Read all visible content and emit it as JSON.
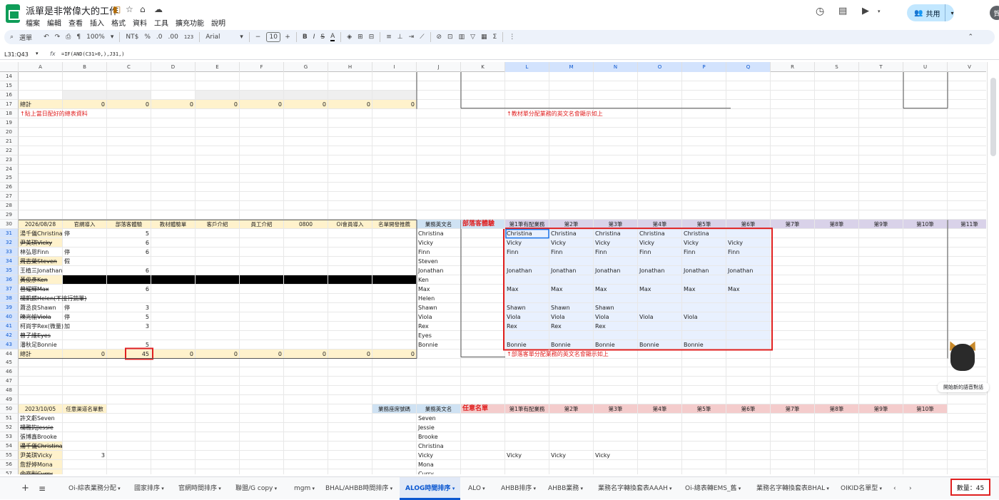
{
  "app": {
    "title": "派單是非常偉大的工作",
    "share_label": "共用",
    "avatar": "賀"
  },
  "menu": [
    "檔案",
    "編輯",
    "查看",
    "插入",
    "格式",
    "資料",
    "工具",
    "擴充功能",
    "說明"
  ],
  "toolbar": {
    "menu_search": "選單",
    "zoom": "100%",
    "currency": "NT$",
    "percent": "%",
    "dec_dec": ".0",
    "dec_inc": ".00",
    "format123": "123",
    "font": "Arial",
    "font_size": "10",
    "functions": "Σ"
  },
  "formula_bar": {
    "name_box": "L31:Q43",
    "fx": "fx",
    "formula": "=IF(AND(C31>0,),J31,)"
  },
  "columns": [
    "A",
    "B",
    "C",
    "D",
    "E",
    "F",
    "G",
    "H",
    "I",
    "J",
    "K",
    "L",
    "M",
    "N",
    "O",
    "P",
    "Q",
    "R",
    "S",
    "T",
    "U",
    "V"
  ],
  "rows": {
    "14": {},
    "15": {},
    "16": {},
    "17": {
      "A": "總計",
      "B": "0",
      "C": "0",
      "D": "0",
      "E": "0",
      "F": "0",
      "G": "0",
      "H": "0",
      "I": "0"
    },
    "18": {
      "A": "↑貼上當日配好的總表資料",
      "L": "↑教材單分配業務的英文名會顯示如上"
    },
    "19": {},
    "20": {},
    "21": {},
    "22": {},
    "23": {},
    "24": {},
    "25": {},
    "26": {},
    "27": {},
    "28": {},
    "29": {},
    "30": {
      "A": "2026/08/28",
      "B": "官網導入",
      "C": "部落客體驗",
      "D": "教材體驗單",
      "E": "客戶介紹",
      "F": "員工介紹",
      "G": "0800",
      "H": "Oi會員導入",
      "I": "名單開發推薦",
      "J": "業務英文名",
      "K": "部落客體驗",
      "L": "第1筆有配業務",
      "M": "第2筆",
      "N": "第3筆",
      "O": "第4筆",
      "P": "第5筆",
      "Q": "第6筆",
      "R": "第7筆",
      "S": "第8筆",
      "T": "第9筆",
      "U": "第10筆",
      "V": "第11筆"
    },
    "31": {
      "A": "湯千儀Christina",
      "B": "停",
      "C": "5",
      "J": "Christina",
      "L": "Christina",
      "M": "Christina",
      "N": "Christina",
      "O": "Christina",
      "P": "Christina"
    },
    "32": {
      "A": "尹美琪Vicky",
      "C": "6",
      "J": "Vicky",
      "L": "Vicky",
      "M": "Vicky",
      "N": "Vicky",
      "O": "Vicky",
      "P": "Vicky",
      "Q": "Vicky"
    },
    "33": {
      "A": "林弘恩Finn",
      "B": "停",
      "C": "6",
      "J": "Finn",
      "L": "Finn",
      "M": "Finn",
      "N": "Finn",
      "O": "Finn",
      "P": "Finn",
      "Q": "Finn"
    },
    "34": {
      "A": "周志榮Steven",
      "B": "假",
      "J": "Steven"
    },
    "35": {
      "A": "王植三Jonathan",
      "C": "6",
      "J": "Jonathan",
      "L": "Jonathan",
      "M": "Jonathan",
      "N": "Jonathan",
      "O": "Jonathan",
      "P": "Jonathan",
      "Q": "Jonathan"
    },
    "36": {
      "A": "黃俊彥Ken",
      "J": "Ken"
    },
    "37": {
      "A": "曾耀輝Max",
      "C": "6",
      "J": "Max",
      "L": "Max",
      "M": "Max",
      "N": "Max",
      "O": "Max",
      "P": "Max",
      "Q": "Max"
    },
    "38": {
      "A": "楊凱麟Helen(不接行銷單)",
      "J": "Helen"
    },
    "39": {
      "A": "蕭丞良Shawn",
      "B": "停",
      "C": "3",
      "J": "Shawn",
      "L": "Shawn",
      "M": "Shawn",
      "N": "Shawn"
    },
    "40": {
      "A": "陳兆愉Viola",
      "B": "停",
      "C": "5",
      "J": "Viola",
      "L": "Viola",
      "M": "Viola",
      "N": "Viola",
      "O": "Viola",
      "P": "Viola"
    },
    "41": {
      "A": "柯尚宇Rex(微量)",
      "B": "加",
      "C": "3",
      "J": "Rex",
      "L": "Rex",
      "M": "Rex",
      "N": "Rex"
    },
    "42": {
      "A": "曾子維Eyes",
      "J": "Eyes"
    },
    "43": {
      "A": "潘秋足Bonnie",
      "C": "5",
      "J": "Bonnie",
      "L": "Bonnie",
      "M": "Bonnie",
      "N": "Bonnie",
      "O": "Bonnie",
      "P": "Bonnie"
    },
    "44": {
      "A": "總計",
      "B": "0",
      "C": "45",
      "D": "0",
      "E": "0",
      "F": "0",
      "G": "0",
      "H": "0",
      "I": "0",
      "L": "↑部落客單分配業務的英文名會顯示如上"
    },
    "45": {},
    "46": {},
    "47": {},
    "48": {},
    "49": {},
    "50": {
      "A": "2023/10/05",
      "B": "任意渠道名單數",
      "I": "業務座席號碼",
      "J": "業務英文名",
      "K": "任意名單",
      "L": "第1筆有配業務",
      "M": "第2筆",
      "N": "第3筆",
      "O": "第4筆",
      "P": "第5筆",
      "Q": "第6筆",
      "R": "第7筆",
      "S": "第8筆",
      "T": "第9筆",
      "U": "第10筆"
    },
    "51": {
      "A": "許文虧Seven",
      "J": "Seven"
    },
    "52": {
      "A": "楊雅鈞Jessie",
      "J": "Jessie"
    },
    "53": {
      "A": "張博鑫Brooke",
      "J": "Brooke"
    },
    "54": {
      "A": "湯千儀Christina",
      "J": "Christina"
    },
    "55": {
      "A": "尹美琪Vicky",
      "B": "3",
      "J": "Vicky",
      "L": "Vicky",
      "M": "Vicky",
      "N": "Vicky"
    },
    "56": {
      "A": "詹舒婷Mona",
      "J": "Mona"
    },
    "57": {
      "A": "余宜則Curry",
      "J": "Curry"
    }
  },
  "tabs": [
    "Oi-綜表業務分配",
    "國家排序",
    "官網時間排序",
    "聯盟/G copy",
    "mgm",
    "BHAL/AHBB時間排序",
    "ALOG時間排序",
    "ALO",
    "AHBB排序",
    "AHBB業務",
    "業務名字轉換套表AAAH",
    "Oi-總表轉EMS_舊",
    "業務名字轉換套表BHAL",
    "OIKID名單型"
  ],
  "active_tab": "ALOG時間排序",
  "status": {
    "count": "數量：45"
  },
  "gemini": {
    "label": "開始新的語音對話"
  },
  "colors": {
    "yellow": "#fff2cc",
    "blue_header": "#cfe2f3",
    "purple_header": "#d9d2e9",
    "pink_header": "#f4cccc",
    "selection": "#e8f0fe",
    "red": "#e02020"
  }
}
